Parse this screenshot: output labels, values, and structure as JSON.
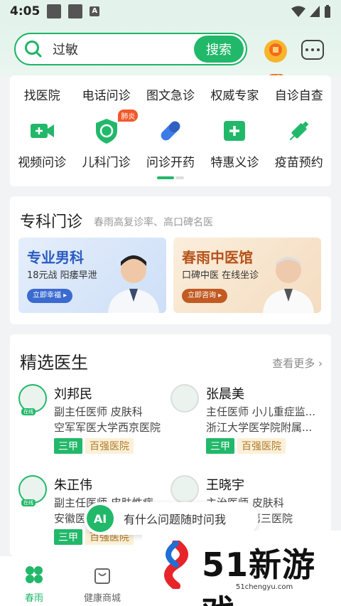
{
  "status_bar": {
    "time": "4:05"
  },
  "search": {
    "placeholder": "过敏",
    "button_label": "搜索"
  },
  "signin": {
    "label": "签到"
  },
  "services": {
    "row1": [
      "找医院",
      "电话问诊",
      "图文急诊",
      "权威专家",
      "自诊自查"
    ],
    "row2": [
      {
        "label": "视频问诊",
        "icon": "video-call-icon"
      },
      {
        "label": "儿科门诊",
        "icon": "pediatric-shield-icon",
        "badge": "肺炎"
      },
      {
        "label": "问诊开药",
        "icon": "pill-capsule-icon"
      },
      {
        "label": "特惠义诊",
        "icon": "medical-kit-icon"
      },
      {
        "label": "疫苗预约",
        "icon": "syringe-icon"
      }
    ]
  },
  "specialty": {
    "title": "专科门诊",
    "subtitle": "春雨高复诊率、高口碑名医",
    "banners": [
      {
        "title": "专业男科",
        "desc": "18元战 阳痿早泄",
        "cta": "立即幸福 ▸"
      },
      {
        "title": "春雨中医馆",
        "desc": "口碑中医 在线坐诊",
        "cta": "立即咨询 ▸"
      }
    ]
  },
  "doctors": {
    "title": "精选医生",
    "more": "查看更多 ›",
    "online_label": "在线",
    "list": [
      {
        "name": "刘邦民",
        "line1": "副主任医师 皮肤科",
        "line2": "空军军医大学西京医院",
        "tag1": "三甲",
        "tag2": "百强医院"
      },
      {
        "name": "张晨美",
        "line1": "主任医师 小儿重症监...",
        "line2": "浙江大学医学院附属...",
        "tag1": "三甲",
        "tag2": "百强医院"
      },
      {
        "name": "朱正伟",
        "line1": "副主任医师 皮肤性病",
        "line2": "安徽医",
        "tag1": "三甲",
        "tag2": "百强医院"
      },
      {
        "name": "王晓宇",
        "line1": "主治医师 皮肤科",
        "line2": "第三医院",
        "tag1": "",
        "tag2": ""
      }
    ]
  },
  "ai_assistant": {
    "icon_text": "AI",
    "prompt": "有什么问题随时问我"
  },
  "tabbar": {
    "home": "春雨",
    "shop": "健康商城"
  },
  "watermark": {
    "brand": "51新游戏",
    "url": "51chengyu.com"
  },
  "colors": {
    "primary": "#22b86a",
    "badge": "#f2582a"
  }
}
